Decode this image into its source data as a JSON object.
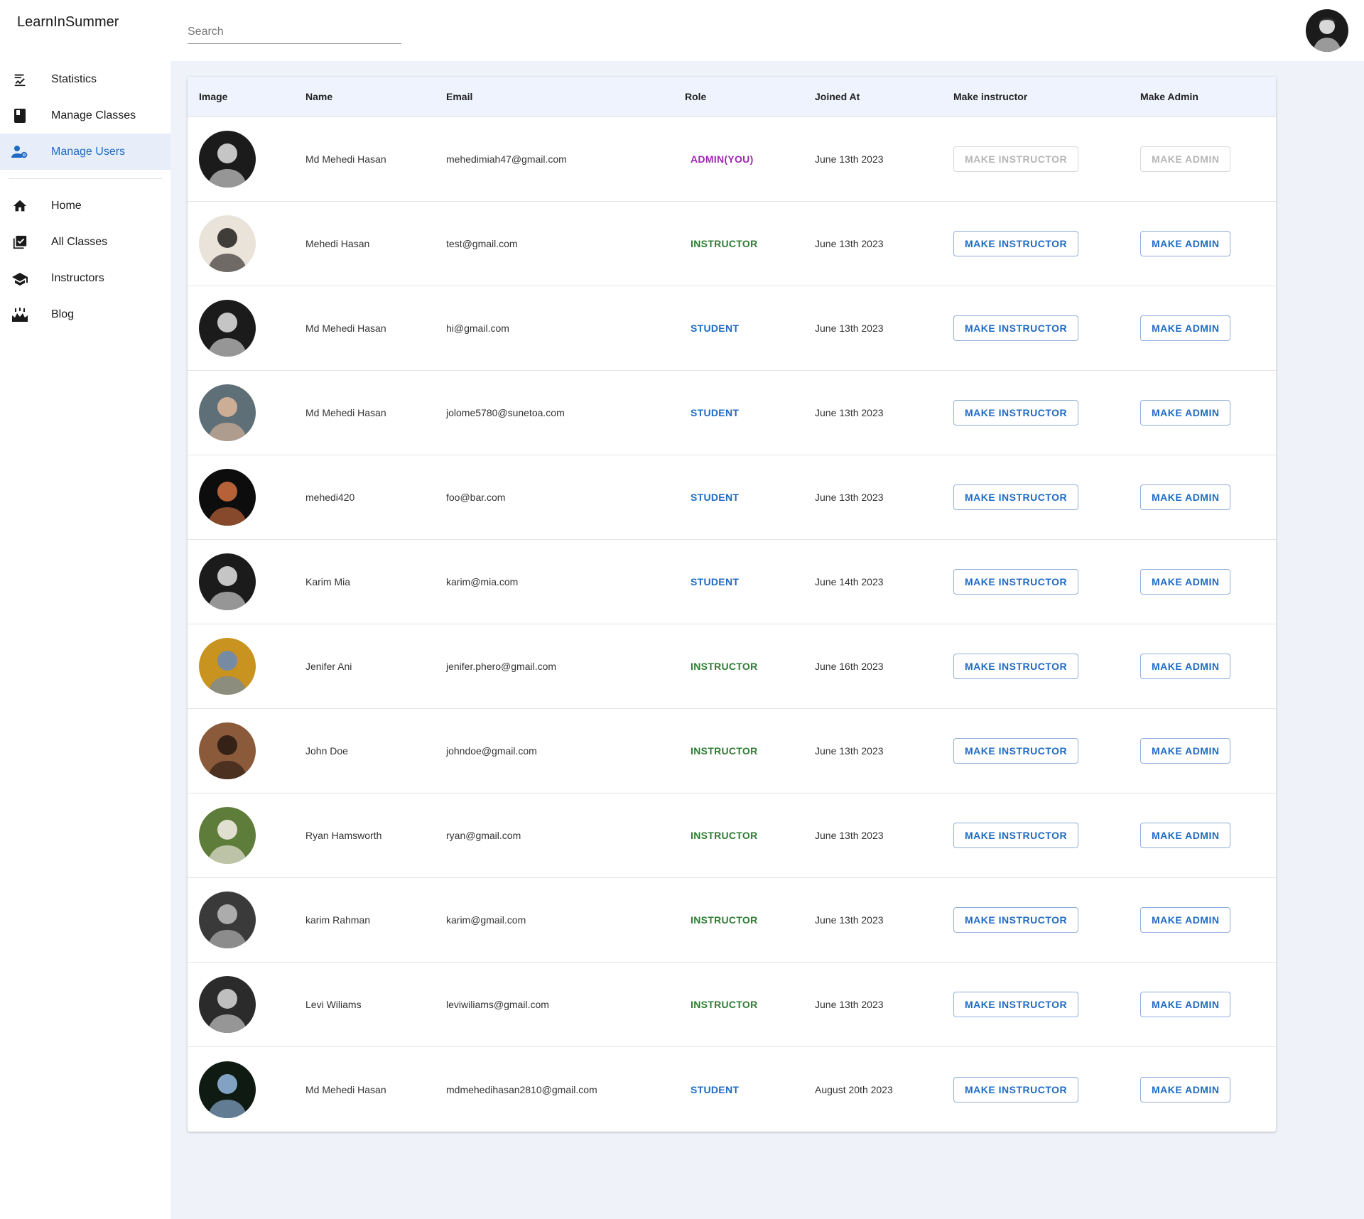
{
  "app": {
    "brand": "LearnInSummer"
  },
  "search": {
    "placeholder": "Search"
  },
  "sidebar": {
    "items": [
      {
        "label": "Statistics",
        "icon": "stats-icon"
      },
      {
        "label": "Manage Classes",
        "icon": "book-icon"
      },
      {
        "label": "Manage Users",
        "icon": "manage-users-icon",
        "active": true
      }
    ],
    "links": [
      {
        "label": "Home",
        "icon": "home-icon"
      },
      {
        "label": "All Classes",
        "icon": "checklist-icon"
      },
      {
        "label": "Instructors",
        "icon": "school-icon"
      },
      {
        "label": "Blog",
        "icon": "blog-icon"
      }
    ]
  },
  "table": {
    "headers": [
      "Image",
      "Name",
      "Email",
      "Role",
      "Joined At",
      "Make instructor",
      "Make Admin"
    ],
    "make_instructor_label": "MAKE INSTRUCTOR",
    "make_admin_label": "MAKE ADMIN",
    "rows": [
      {
        "name": "Md Mehedi Hasan",
        "email": "mehedimiah47@gmail.com",
        "role": "ADMIN(YOU)",
        "role_type": "admin",
        "joined": "June 13th 2023",
        "disabled": true,
        "avatar_bg": "#1b1b1b",
        "avatar_fg": "#d8d8d8"
      },
      {
        "name": "Mehedi Hasan",
        "email": "test@gmail.com",
        "role": "INSTRUCTOR",
        "role_type": "instructor",
        "joined": "June 13th 2023",
        "disabled": false,
        "avatar_bg": "#e9e3da",
        "avatar_fg": "#2e2a26"
      },
      {
        "name": "Md Mehedi Hasan",
        "email": "hi@gmail.com",
        "role": "STUDENT",
        "role_type": "student",
        "joined": "June 13th 2023",
        "disabled": false,
        "avatar_bg": "#1b1b1b",
        "avatar_fg": "#d8d8d8"
      },
      {
        "name": "Md Mehedi Hasan",
        "email": "jolome5780@sunetoa.com",
        "role": "STUDENT",
        "role_type": "student",
        "joined": "June 13th 2023",
        "disabled": false,
        "avatar_bg": "#5f6f78",
        "avatar_fg": "#d8b59a"
      },
      {
        "name": "mehedi420",
        "email": "foo@bar.com",
        "role": "STUDENT",
        "role_type": "student",
        "joined": "June 13th 2023",
        "disabled": false,
        "avatar_bg": "#0d0d0d",
        "avatar_fg": "#c96a3c"
      },
      {
        "name": "Karim Mia",
        "email": "karim@mia.com",
        "role": "STUDENT",
        "role_type": "student",
        "joined": "June 14th 2023",
        "disabled": false,
        "avatar_bg": "#1b1b1b",
        "avatar_fg": "#d8d8d8"
      },
      {
        "name": "Jenifer Ani",
        "email": "jenifer.phero@gmail.com",
        "role": "INSTRUCTOR",
        "role_type": "instructor",
        "joined": "June 16th 2023",
        "disabled": false,
        "avatar_bg": "#c8931f",
        "avatar_fg": "#6d8bb0"
      },
      {
        "name": "John Doe",
        "email": "johndoe@gmail.com",
        "role": "INSTRUCTOR",
        "role_type": "instructor",
        "joined": "June 13th 2023",
        "disabled": false,
        "avatar_bg": "#8a5a3a",
        "avatar_fg": "#2b1c14"
      },
      {
        "name": "Ryan Hamsworth",
        "email": "ryan@gmail.com",
        "role": "INSTRUCTOR",
        "role_type": "instructor",
        "joined": "June 13th 2023",
        "disabled": false,
        "avatar_bg": "#5f7d3a",
        "avatar_fg": "#efeae0"
      },
      {
        "name": "karim Rahman",
        "email": "karim@gmail.com",
        "role": "INSTRUCTOR",
        "role_type": "instructor",
        "joined": "June 13th 2023",
        "disabled": false,
        "avatar_bg": "#3a3a3a",
        "avatar_fg": "#b9b9b9"
      },
      {
        "name": "Levi Wiliams",
        "email": "leviwiliams@gmail.com",
        "role": "INSTRUCTOR",
        "role_type": "instructor",
        "joined": "June 13th 2023",
        "disabled": false,
        "avatar_bg": "#2b2b2b",
        "avatar_fg": "#cfcfcf"
      },
      {
        "name": "Md Mehedi Hasan",
        "email": "mdmehedihasan2810@gmail.com",
        "role": "STUDENT",
        "role_type": "student",
        "joined": "August 20th 2023",
        "disabled": false,
        "avatar_bg": "#0f1a12",
        "avatar_fg": "#8fb1d8"
      }
    ]
  }
}
